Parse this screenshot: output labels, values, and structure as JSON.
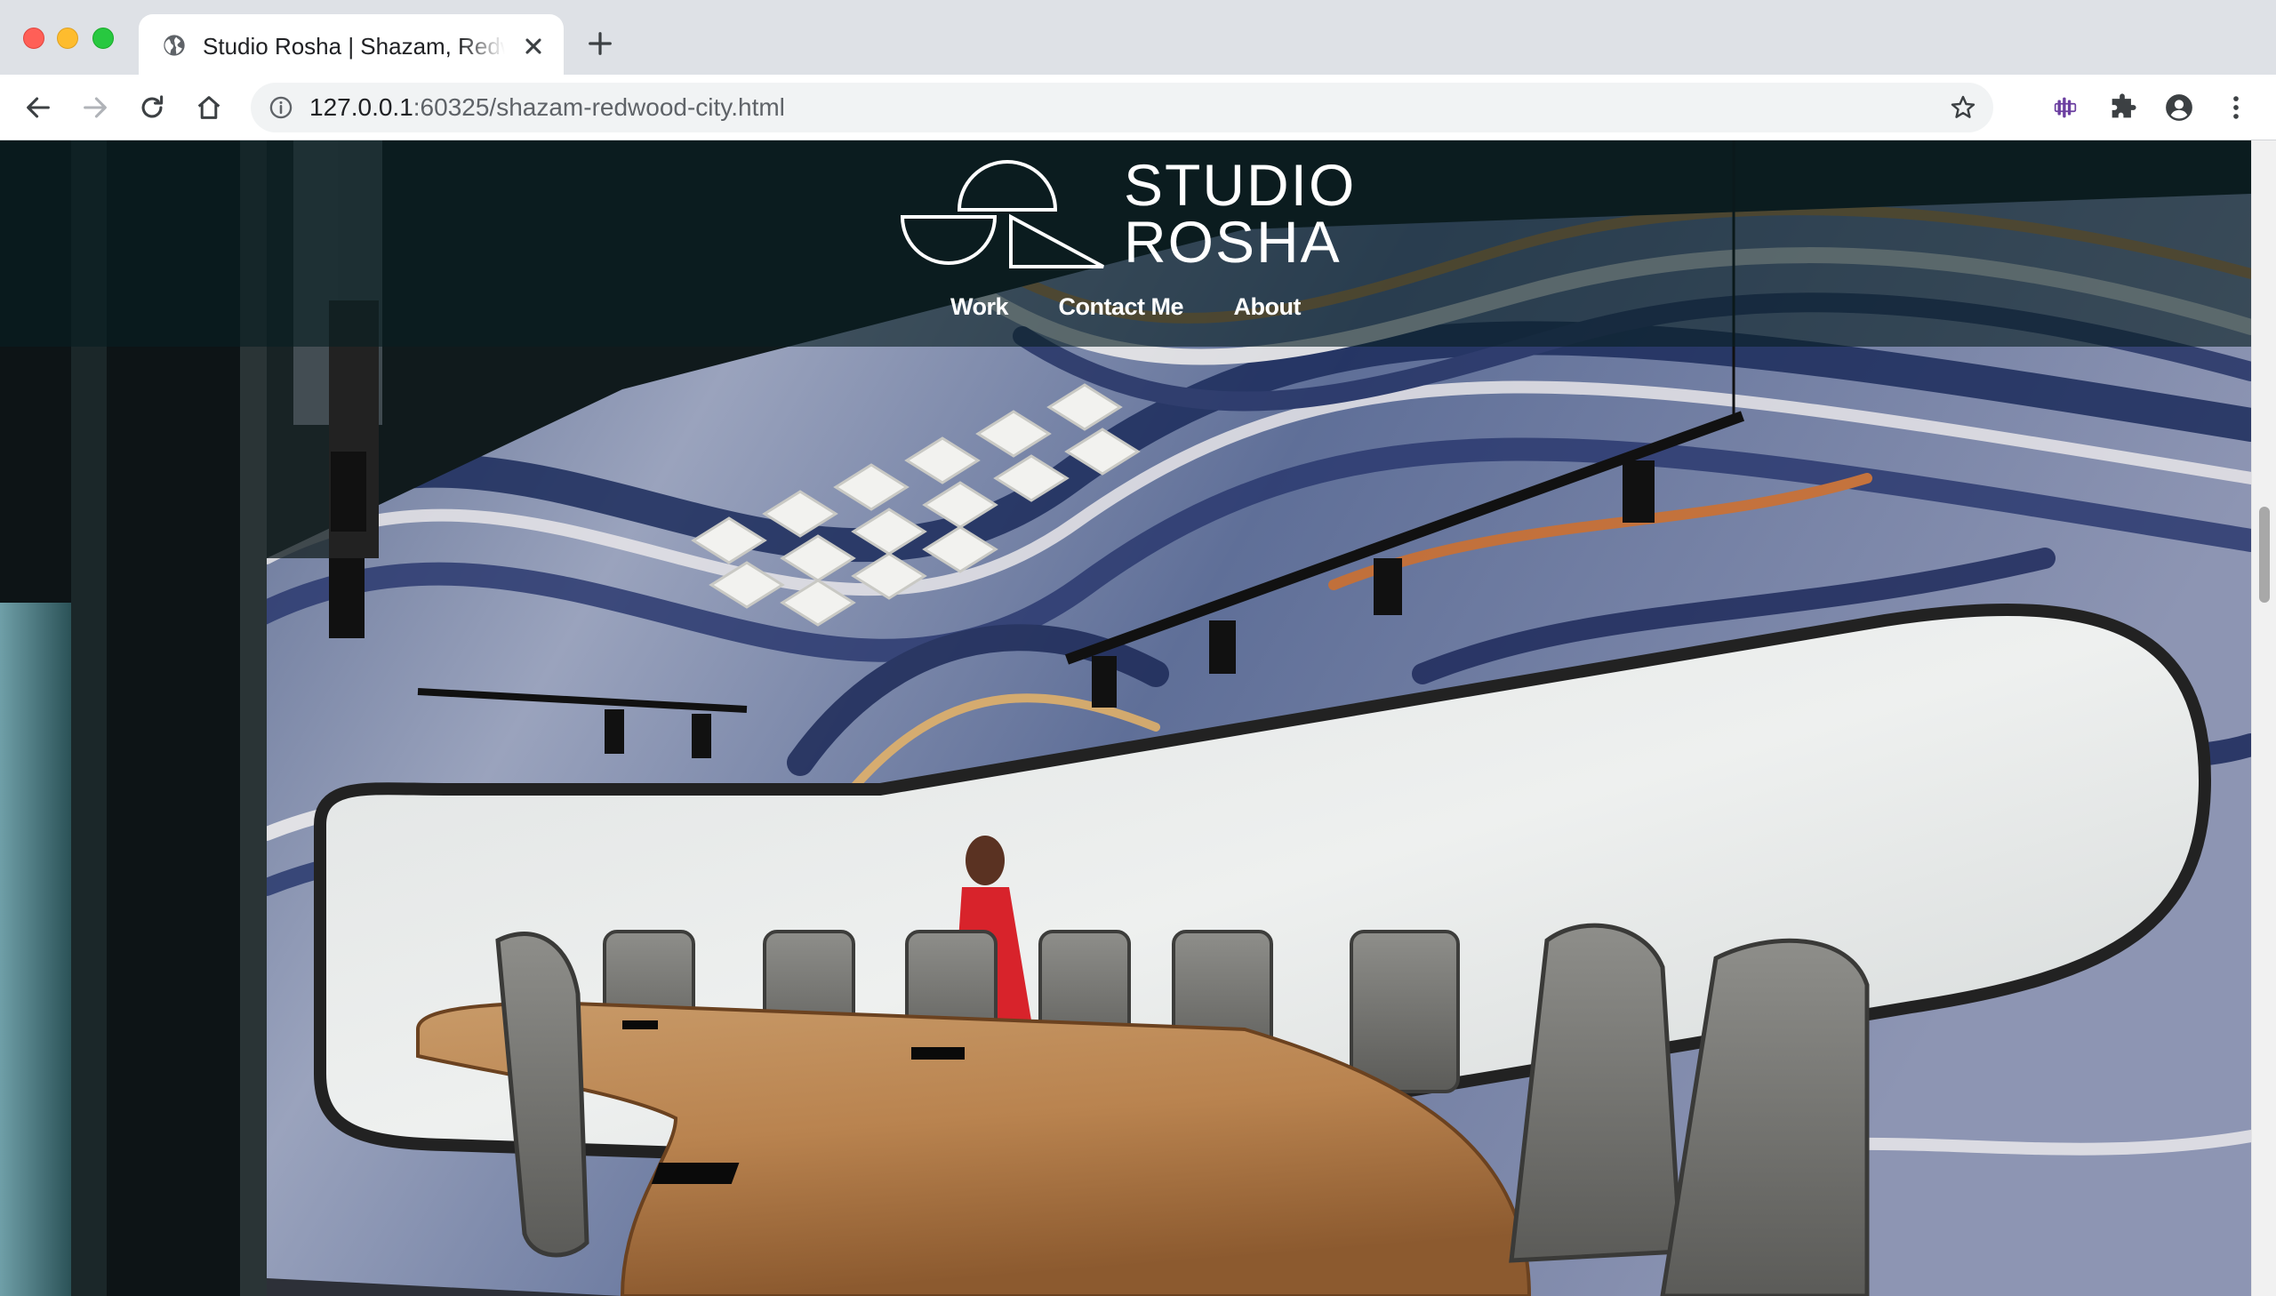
{
  "browser": {
    "tab_title": "Studio Rosha | Shazam, Redwood City",
    "url_host": "127.0.0.1",
    "url_rest": ":60325/shazam-redwood-city.html"
  },
  "site": {
    "logo_line1": "STUDIO",
    "logo_line2": "ROSHA",
    "nav": [
      "Work",
      "Contact Me",
      "About"
    ]
  },
  "colors": {
    "chrome_bg": "#dee1e6",
    "header_overlay": "#081e22",
    "accent_extension": "#6b3fa0"
  }
}
